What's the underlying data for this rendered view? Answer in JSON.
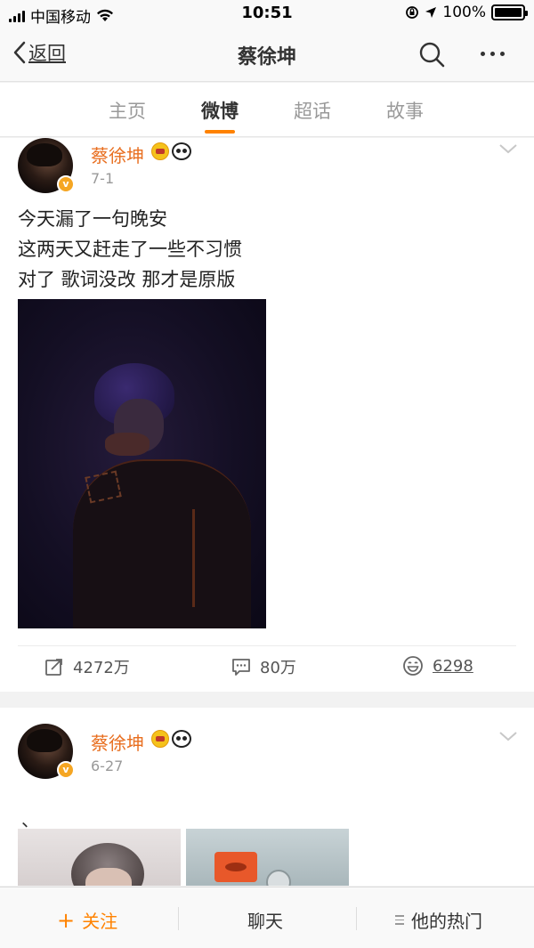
{
  "status_bar": {
    "carrier": "中国移动",
    "time": "10:51",
    "battery_percent": "100%",
    "battery_level": 1.0
  },
  "nav": {
    "back_label": "返回",
    "title": "蔡徐坤",
    "icons": [
      "chevron-left-icon",
      "search-icon",
      "more-icon"
    ]
  },
  "tabs": [
    {
      "label": "主页",
      "active": false
    },
    {
      "label": "微博",
      "active": true
    },
    {
      "label": "超话",
      "active": false
    },
    {
      "label": "故事",
      "active": false
    }
  ],
  "posts": [
    {
      "user_name": "蔡徐坤",
      "date": "7-1",
      "text_lines": [
        "今天漏了一句晚安",
        "这两天又赶走了一些不习惯",
        "对了 歌词没改 那才是原版"
      ],
      "repost_count": "4272万",
      "comment_count": "80万",
      "like_count": "6298"
    },
    {
      "user_name": "蔡徐坤",
      "date": "6-27",
      "text": "、"
    }
  ],
  "bottom_bar": {
    "follow_label": "关注",
    "follow_icon": "+",
    "chat_label": "聊天",
    "hot_label": "他的热门"
  },
  "colors": {
    "accent_orange": "#ff8200",
    "username_orange": "#e86e1f",
    "verified_badge": "#f5a623"
  }
}
